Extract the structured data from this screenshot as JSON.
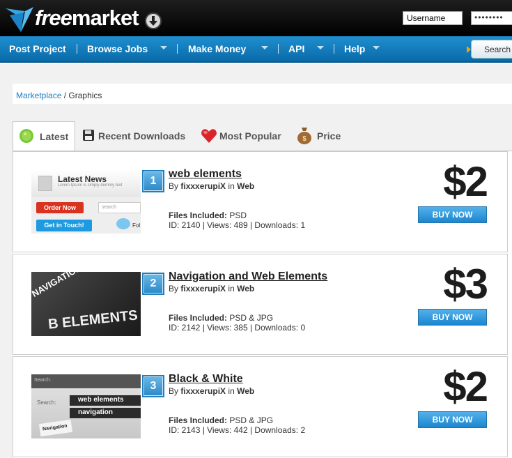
{
  "header": {
    "logo_text_free": "free",
    "logo_text_market": "market",
    "username_placeholder": "Username",
    "password_mask": "••••••••"
  },
  "nav": {
    "items": [
      {
        "label": "Post Project"
      },
      {
        "label": "Browse Jobs"
      },
      {
        "label": "Make Money"
      },
      {
        "label": "API"
      },
      {
        "label": "Help"
      }
    ],
    "search_label": "Search"
  },
  "breadcrumb": {
    "root": "Marketplace",
    "separator": "/",
    "current": "Graphics"
  },
  "tabs": [
    {
      "label": "Latest",
      "icon": "green-gear-icon"
    },
    {
      "label": "Recent Downloads",
      "icon": "floppy-disk-icon"
    },
    {
      "label": "Most Popular",
      "icon": "heart-icon"
    },
    {
      "label": "Price",
      "icon": "money-bag-icon"
    }
  ],
  "items": [
    {
      "rank": "1",
      "title": "web elements",
      "by": "By",
      "author": "fixxxerupiX",
      "in": "in",
      "category": "Web",
      "files_label": "Files Included:",
      "files_value": "PSD",
      "meta": "ID: 2140 | Views: 489 | Downloads: 1",
      "price": "$2",
      "buy_label": "BUY NOW",
      "thumb": {
        "heading": "Latest News",
        "sub": "Lorem Ipsum is simply dummy text",
        "order_btn": "Order Now",
        "search": "search",
        "touch_btn": "Get in Touch!",
        "follow": "Fol"
      }
    },
    {
      "rank": "2",
      "title": "Navigation and Web Elements",
      "by": "By",
      "author": "fixxxerupiX",
      "in": "in",
      "category": "Web",
      "files_label": "Files Included:",
      "files_value": "PSD & JPG",
      "meta": "ID: 2142 | Views: 385 | Downloads: 0",
      "price": "$3",
      "buy_label": "BUY NOW",
      "thumb": {
        "line1": "NAVIGATION & WEB ELEM",
        "line2": "B ELEMENTS"
      }
    },
    {
      "rank": "3",
      "title": "Black & White",
      "by": "By",
      "author": "fixxxerupiX",
      "in": "in",
      "category": "Web",
      "files_label": "Files Included:",
      "files_value": "PSD & JPG",
      "meta": "ID: 2143 | Views: 442 | Downloads: 2",
      "price": "$2",
      "buy_label": "BUY NOW",
      "thumb": {
        "search1": "Search:",
        "search2": "Search:",
        "tag1": "web elements",
        "tag2": "navigation",
        "tag3": "Navigation"
      }
    }
  ]
}
